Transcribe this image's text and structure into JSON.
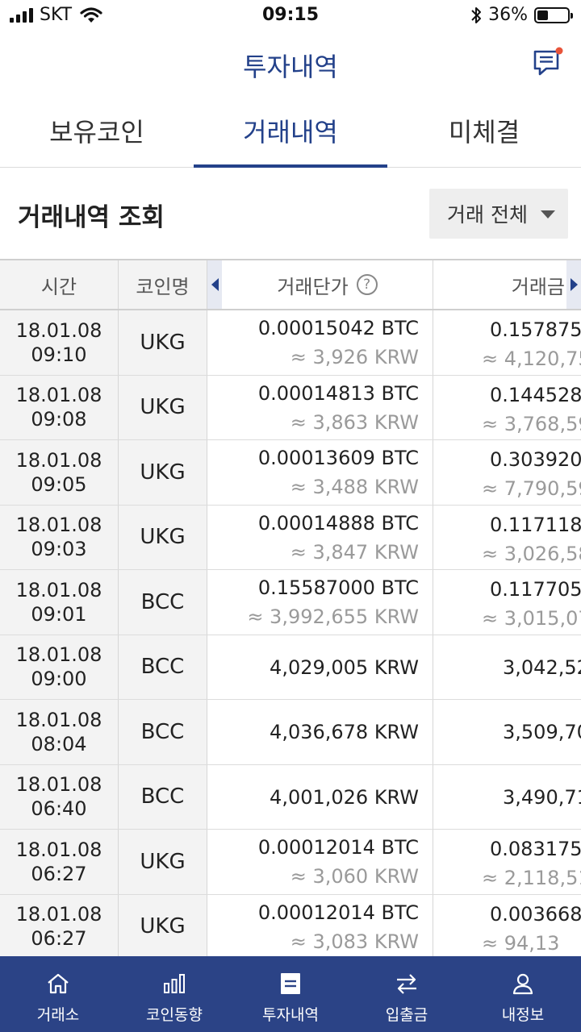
{
  "status_bar": {
    "carrier": "SKT",
    "time": "09:15",
    "battery": "36%",
    "battery_level": 0.36
  },
  "header": {
    "title": "투자내역"
  },
  "tabs": [
    {
      "label": "보유코인",
      "active": false
    },
    {
      "label": "거래내역",
      "active": true
    },
    {
      "label": "미체결",
      "active": false
    }
  ],
  "section": {
    "title": "거래내역 조회",
    "filter_label": "거래 전체"
  },
  "table": {
    "columns": {
      "time": "시간",
      "coin": "코인명",
      "price": "거래단가",
      "amount": "거래금"
    },
    "rows": [
      {
        "date": "18.01.08",
        "time": "09:10",
        "coin": "UKG",
        "price": "0.00015042 BTC",
        "price_krw": "≈ 3,926 KRW",
        "amount": "0.157875",
        "amount_krw": "≈ 4,120,75"
      },
      {
        "date": "18.01.08",
        "time": "09:08",
        "coin": "UKG",
        "price": "0.00014813 BTC",
        "price_krw": "≈ 3,863 KRW",
        "amount": "0.144528",
        "amount_krw": "≈ 3,768,59"
      },
      {
        "date": "18.01.08",
        "time": "09:05",
        "coin": "UKG",
        "price": "0.00013609 BTC",
        "price_krw": "≈ 3,488 KRW",
        "amount": "0.303920",
        "amount_krw": "≈ 7,790,59"
      },
      {
        "date": "18.01.08",
        "time": "09:03",
        "coin": "UKG",
        "price": "0.00014888 BTC",
        "price_krw": "≈ 3,847 KRW",
        "amount": "0.117118",
        "amount_krw": "≈ 3,026,58"
      },
      {
        "date": "18.01.08",
        "time": "09:01",
        "coin": "BCC",
        "price": "0.15587000 BTC",
        "price_krw": "≈ 3,992,655 KRW",
        "amount": "0.117705",
        "amount_krw": "≈ 3,015,07"
      },
      {
        "date": "18.01.08",
        "time": "09:00",
        "coin": "BCC",
        "price": "4,029,005 KRW",
        "price_krw": "",
        "amount": "3,042,52",
        "amount_krw": ""
      },
      {
        "date": "18.01.08",
        "time": "08:04",
        "coin": "BCC",
        "price": "4,036,678 KRW",
        "price_krw": "",
        "amount": "3,509,70",
        "amount_krw": ""
      },
      {
        "date": "18.01.08",
        "time": "06:40",
        "coin": "BCC",
        "price": "4,001,026 KRW",
        "price_krw": "",
        "amount": "3,490,71",
        "amount_krw": ""
      },
      {
        "date": "18.01.08",
        "time": "06:27",
        "coin": "UKG",
        "price": "0.00012014 BTC",
        "price_krw": "≈ 3,060 KRW",
        "amount": "0.083175",
        "amount_krw": "≈ 2,118,51"
      },
      {
        "date": "18.01.08",
        "time": "06:27",
        "coin": "UKG",
        "price": "0.00012014 BTC",
        "price_krw": "≈ 3,083 KRW",
        "amount": "0.003668",
        "amount_krw": "≈ 94,13"
      }
    ]
  },
  "bottom_nav": [
    {
      "label": "거래소",
      "icon": "home-icon"
    },
    {
      "label": "코인동향",
      "icon": "bar-chart-icon"
    },
    {
      "label": "투자내역",
      "icon": "document-icon"
    },
    {
      "label": "입출금",
      "icon": "transfer-icon"
    },
    {
      "label": "내정보",
      "icon": "user-icon"
    }
  ],
  "colors": {
    "brand": "#23418a",
    "nav_background": "#2b4386",
    "badge": "#e8543a"
  }
}
